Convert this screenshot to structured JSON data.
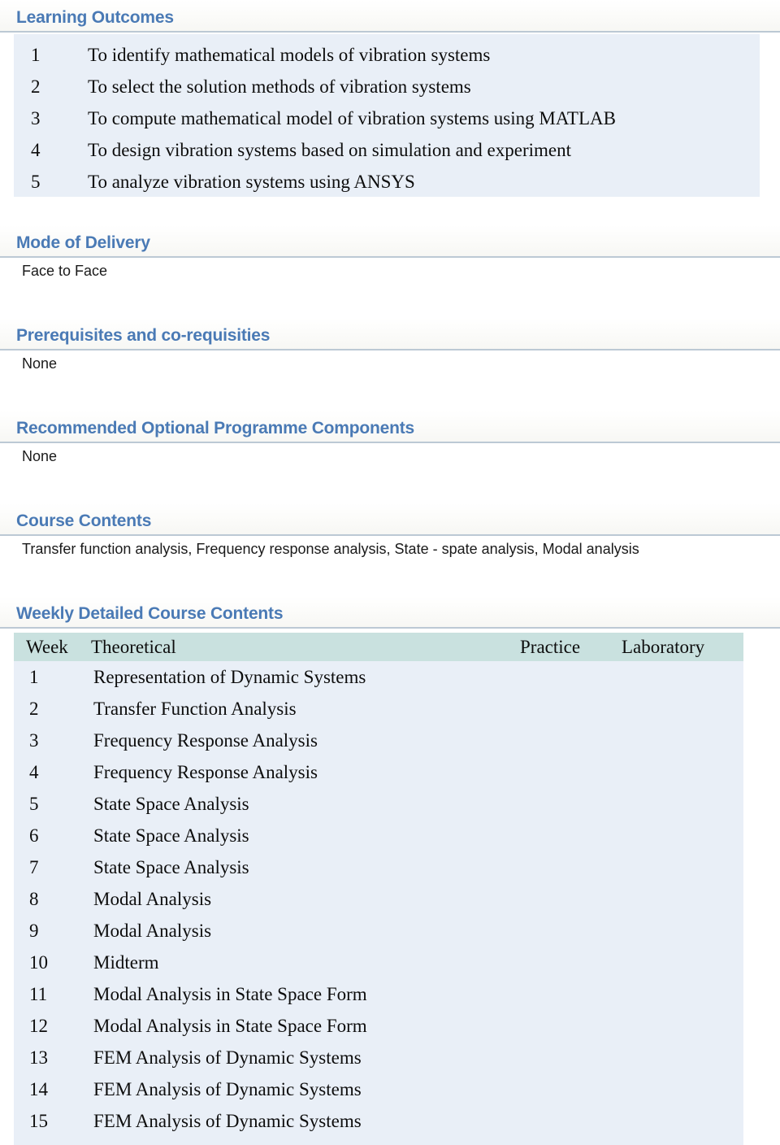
{
  "sections": {
    "learning_outcomes": {
      "heading": "Learning Outcomes",
      "items": [
        {
          "num": "1",
          "text": "To identify mathematical models of vibration systems"
        },
        {
          "num": "2",
          "text": "To select the solution methods of vibration systems"
        },
        {
          "num": "3",
          "text": "To compute mathematical model of vibration systems using MATLAB"
        },
        {
          "num": "4",
          "text": "To design vibration systems based on simulation and experiment"
        },
        {
          "num": "5",
          "text": "To analyze vibration systems using ANSYS"
        }
      ]
    },
    "mode_of_delivery": {
      "heading": "Mode of Delivery",
      "value": "Face to Face"
    },
    "prerequisites": {
      "heading": "Prerequisites and co-requisities",
      "value": "None"
    },
    "recommended_components": {
      "heading": "Recommended Optional Programme Components",
      "value": "None"
    },
    "course_contents": {
      "heading": "Course Contents",
      "value": "Transfer function analysis, Frequency response analysis, State - spate analysis, Modal analysis"
    },
    "weekly": {
      "heading": "Weekly Detailed Course Contents",
      "columns": {
        "week": "Week",
        "theoretical": "Theoretical",
        "practice": "Practice",
        "laboratory": "Laboratory"
      },
      "rows": [
        {
          "week": "1",
          "theoretical": "Representation of Dynamic Systems",
          "practice": "",
          "laboratory": ""
        },
        {
          "week": "2",
          "theoretical": "Transfer Function Analysis",
          "practice": "",
          "laboratory": ""
        },
        {
          "week": "3",
          "theoretical": "Frequency Response Analysis",
          "practice": "",
          "laboratory": ""
        },
        {
          "week": "4",
          "theoretical": "Frequency Response Analysis",
          "practice": "",
          "laboratory": ""
        },
        {
          "week": "5",
          "theoretical": "State Space Analysis",
          "practice": "",
          "laboratory": ""
        },
        {
          "week": "6",
          "theoretical": "State Space Analysis",
          "practice": "",
          "laboratory": ""
        },
        {
          "week": "7",
          "theoretical": "State Space Analysis",
          "practice": "",
          "laboratory": ""
        },
        {
          "week": "8",
          "theoretical": "Modal Analysis",
          "practice": "",
          "laboratory": ""
        },
        {
          "week": "9",
          "theoretical": "Modal Analysis",
          "practice": "",
          "laboratory": ""
        },
        {
          "week": "10",
          "theoretical": "Midterm",
          "practice": "",
          "laboratory": ""
        },
        {
          "week": "11",
          "theoretical": "Modal Analysis in State Space Form",
          "practice": "",
          "laboratory": ""
        },
        {
          "week": "12",
          "theoretical": "Modal Analysis in State Space Form",
          "practice": "",
          "laboratory": ""
        },
        {
          "week": "13",
          "theoretical": "FEM Analysis of Dynamic Systems",
          "practice": "",
          "laboratory": ""
        },
        {
          "week": "14",
          "theoretical": "FEM Analysis of Dynamic Systems",
          "practice": "",
          "laboratory": ""
        },
        {
          "week": "15",
          "theoretical": "FEM Analysis of Dynamic Systems",
          "practice": "",
          "laboratory": ""
        }
      ]
    }
  },
  "colors": {
    "heading_text": "#4a7ab5",
    "panel_bg": "#e9eff7",
    "table_header_bg": "#c9e1df",
    "heading_rule": "#bcc9d4"
  }
}
